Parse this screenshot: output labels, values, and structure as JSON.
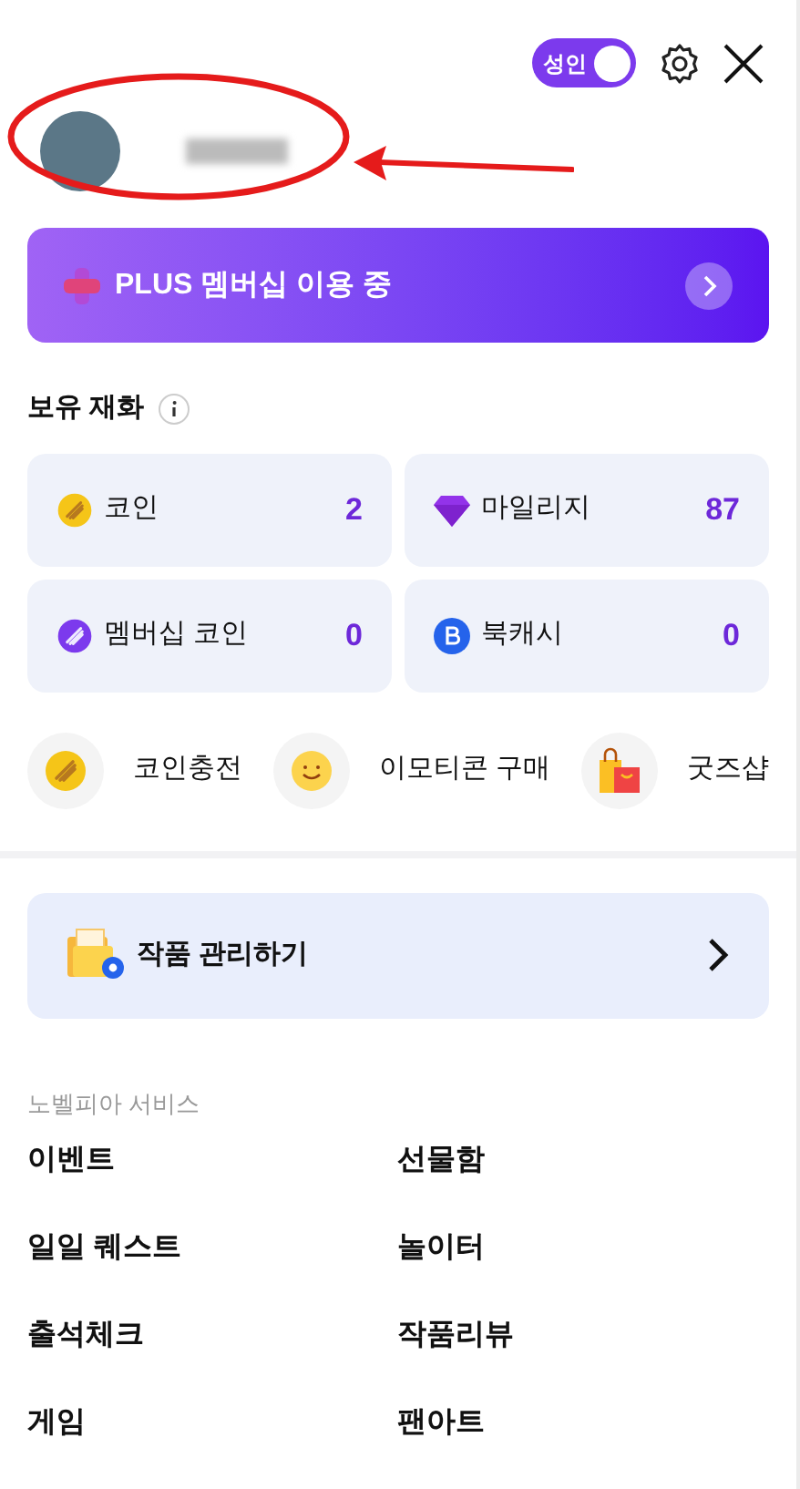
{
  "header": {
    "adult_toggle": {
      "label": "성인",
      "on": true
    }
  },
  "membership_banner": {
    "label": "PLUS 멤버십 이용 중"
  },
  "wallet": {
    "title": "보유 재화",
    "items": [
      {
        "kind": "coin",
        "label": "코인",
        "value": "2"
      },
      {
        "kind": "gem",
        "label": "마일리지",
        "value": "87"
      },
      {
        "kind": "member-coin",
        "label": "멤버십 코인",
        "value": "0"
      },
      {
        "kind": "bookcash",
        "label": "북캐시",
        "value": "0"
      }
    ]
  },
  "quick_actions": [
    {
      "kind": "coin",
      "label": "코인충전"
    },
    {
      "kind": "emoticon",
      "label": "이모티콘 구매"
    },
    {
      "kind": "shop",
      "label": "굿즈샵"
    }
  ],
  "manage_card": {
    "label": "작품 관리하기"
  },
  "services": {
    "title": "노벨피아 서비스",
    "items": [
      "이벤트",
      "선물함",
      "일일 퀘스트",
      "놀이터",
      "출석체크",
      "작품리뷰",
      "게임",
      "팬아트"
    ]
  }
}
